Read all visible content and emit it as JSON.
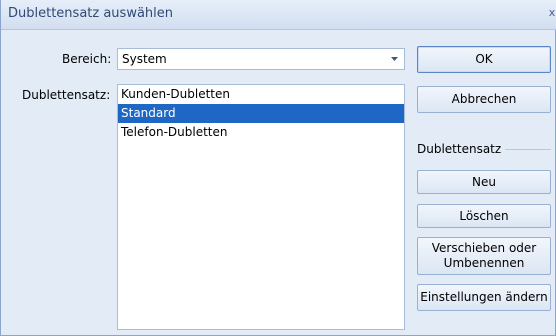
{
  "window": {
    "title": "Dublettensatz auswählen",
    "close_glyph": "x"
  },
  "form": {
    "bereich_label": "Bereich:",
    "bereich_value": "System",
    "dublettensatz_label": "Dublettensatz:",
    "items": [
      {
        "label": "Kunden-Dubletten",
        "selected": false
      },
      {
        "label": "Standard",
        "selected": true
      },
      {
        "label": "Telefon-Dubletten",
        "selected": false
      }
    ]
  },
  "buttons": {
    "ok": "OK",
    "cancel": "Abbrechen",
    "group_title": "Dublettensatz",
    "new": "Neu",
    "delete": "Löschen",
    "move_line1": "Verschieben oder",
    "move_line2": "Umbenennen",
    "settings": "Einstellungen ändern"
  },
  "colors": {
    "selection": "#1f67c4",
    "window_bg": "#e2ebf6",
    "title_text": "#2f4a74"
  },
  "icons": {
    "combo_arrow": "chevron-down-icon",
    "close": "close-icon"
  }
}
